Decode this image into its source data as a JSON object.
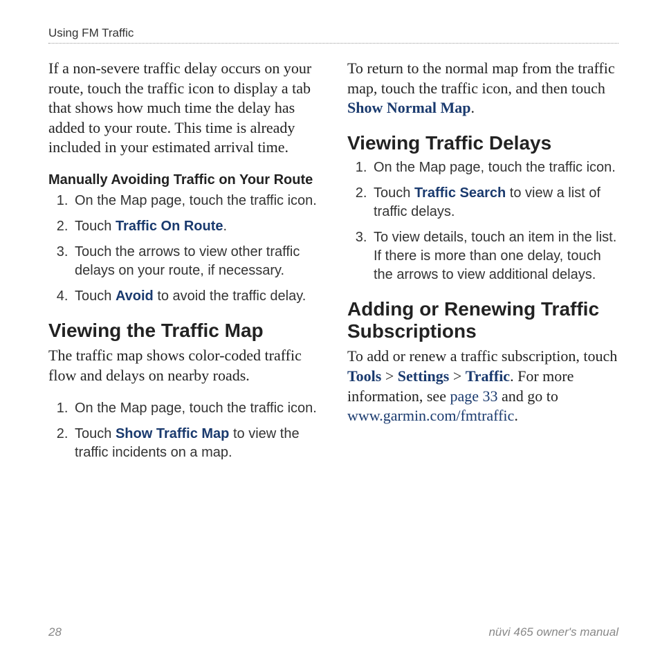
{
  "runningHead": "Using FM Traffic",
  "footer": {
    "pageNum": "28",
    "manual": "nüvi 465 owner's manual"
  },
  "left": {
    "introPara": "If a non-severe traffic delay occurs on your route, touch the traffic icon to display a tab that shows how much time the delay has added to your route. This time is already included in your estimated arrival time.",
    "manual": {
      "heading": "Manually Avoiding Traffic on Your Route",
      "steps": {
        "s1": "On the Map page, touch the traffic icon.",
        "s2a": "Touch ",
        "s2b": "Traffic On Route",
        "s2c": ".",
        "s3": "Touch the arrows to view other traffic delays on your route, if necessary.",
        "s4a": "Touch ",
        "s4b": "Avoid",
        "s4c": " to avoid the traffic delay."
      }
    },
    "viewMap": {
      "heading": "Viewing the Traffic Map",
      "intro": "The traffic map shows color-coded traffic flow and delays on nearby roads.",
      "steps": {
        "s1": "On the Map page, touch the traffic icon.",
        "s2a": "Touch ",
        "s2b": "Show Traffic Map",
        "s2c": " to view the traffic incidents on a map."
      }
    }
  },
  "right": {
    "returnPara": {
      "a": "To return to the normal map from the traffic map, touch the traffic icon, and then touch ",
      "b": "Show Normal Map",
      "c": "."
    },
    "delays": {
      "heading": "Viewing Traffic Delays",
      "steps": {
        "s1": "On the Map page, touch the traffic icon.",
        "s2a": "Touch ",
        "s2b": "Traffic Search",
        "s2c": " to view a list of traffic delays.",
        "s3": "To view details, touch an item in the list. If there is more than one delay, touch the arrows to view additional delays."
      }
    },
    "subs": {
      "heading": "Adding or Renewing Traffic Subscriptions",
      "para": {
        "a": "To add or renew a traffic subscription, touch ",
        "tools": "Tools",
        "gt1": " > ",
        "settings": "Settings",
        "gt2": " > ",
        "traffic": "Traffic",
        "b": ". For more information, see ",
        "pageRef": "page 33",
        "c": " and go to ",
        "url": "www.garmin.com/fmtraffic",
        "d": "."
      }
    }
  }
}
